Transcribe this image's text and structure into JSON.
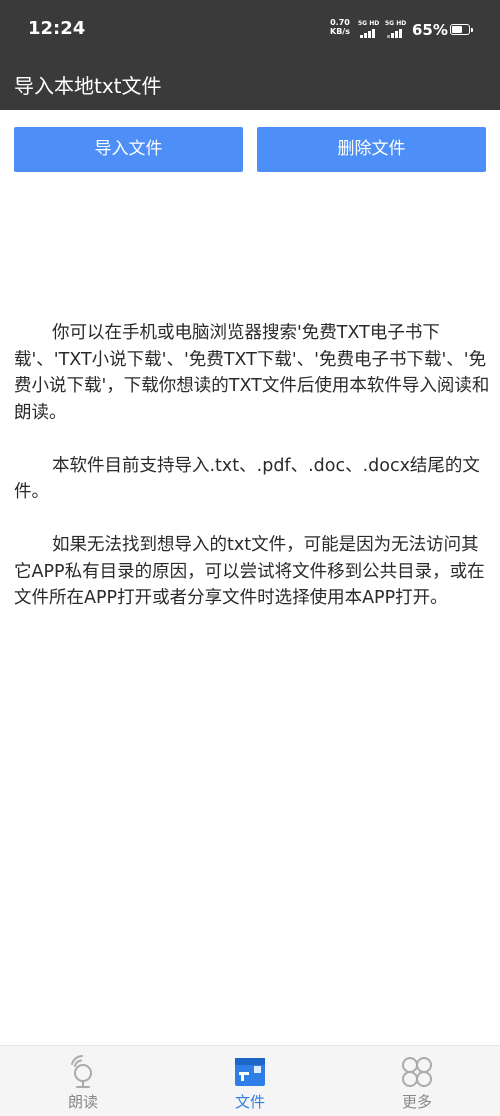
{
  "status_bar": {
    "time": "12:24",
    "speed_value": "0.70",
    "speed_unit": "KB/s",
    "sim1_tag": "5G HD",
    "sim2_tag": "5G HD",
    "battery": "65%",
    "battery_level": 0.65
  },
  "app_bar": {
    "title": "导入本地txt文件"
  },
  "actions": {
    "import_label": "导入文件",
    "delete_label": "删除文件"
  },
  "content": {
    "paragraphs": [
      "你可以在手机或电脑浏览器搜索'免费TXT电子书下载'、'TXT小说下载'、'免费TXT下载'、'免费电子书下载'、'免费小说下载'，下载你想读的TXT文件后使用本软件导入阅读和朗读。",
      "本软件目前支持导入.txt、.pdf、.doc、.docx结尾的文件。",
      "如果无法找到想导入的txt文件，可能是因为无法访问其它APP私有目录的原因，可以尝试将文件移到公共目录，或在文件所在APP打开或者分享文件时选择使用本APP打开。"
    ]
  },
  "bottom_nav": {
    "items": [
      {
        "label": "朗读",
        "icon": "read-aloud-icon",
        "active": false
      },
      {
        "label": "文件",
        "icon": "file-icon",
        "active": true
      },
      {
        "label": "更多",
        "icon": "more-grid-icon",
        "active": false
      }
    ]
  },
  "colors": {
    "bar_bg": "#3a3a3a",
    "button_bg": "#4d8ff7",
    "active_nav": "#2f7ee8",
    "inactive_nav": "#888888"
  }
}
